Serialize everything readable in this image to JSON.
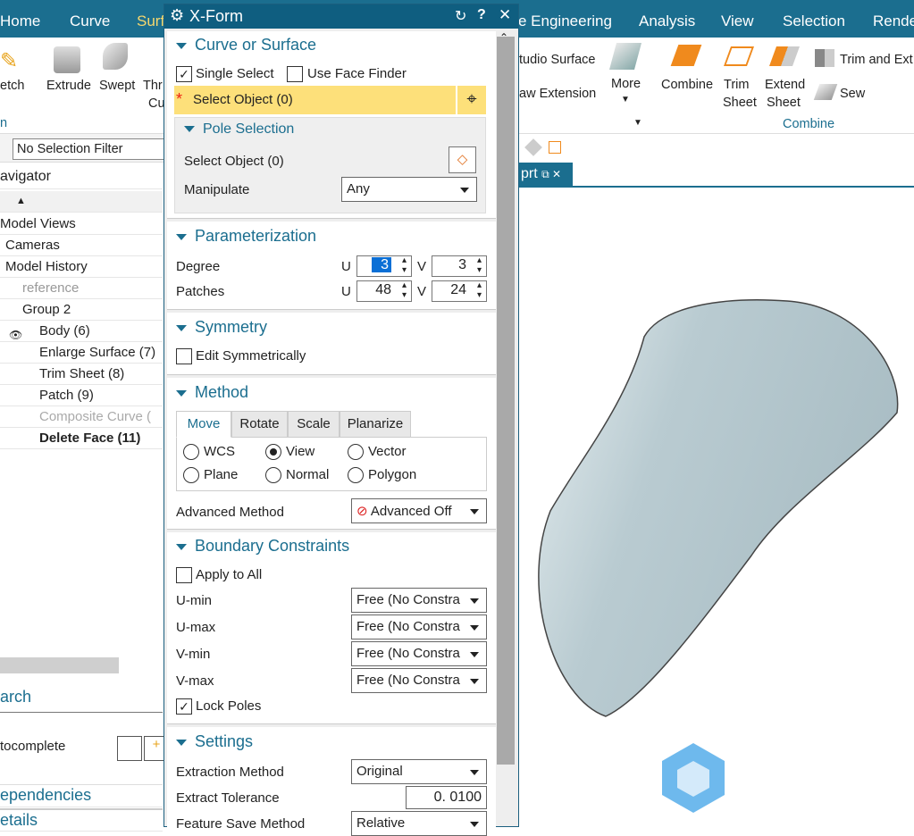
{
  "ribbon": {
    "tabs": [
      "Home",
      "Curve",
      "Surf",
      "e Engineering",
      "Analysis",
      "View",
      "Selection",
      "Rende"
    ],
    "buttons": {
      "sketch": "etch",
      "extrude": "Extrude",
      "swept": "Swept",
      "through": "Thr",
      "through2": "Cu",
      "studio": "tudio Surface",
      "extension": "aw Extension",
      "more": "More",
      "combine": "Combine",
      "trim_sheet_1": "Trim",
      "trim_sheet_2": "Sheet",
      "extend_sheet_1": "Extend",
      "extend_sheet_2": "Sheet",
      "trim_extend": "Trim and Ext",
      "sew": "Sew"
    },
    "group_left": "n",
    "group_combine": "Combine"
  },
  "selection_filter": "No Selection Filter",
  "navigator": {
    "title": "avigator",
    "items": [
      "Model Views",
      "Cameras",
      "Model History",
      "reference",
      "Group 2",
      "Body (6)",
      "Enlarge Surface (7)",
      "Trim Sheet (8)",
      "Patch (9)",
      "Composite Curve (",
      "Delete Face (11)"
    ],
    "search": "arch",
    "autocomplete": "tocomplete",
    "dependencies": "ependencies",
    "details": "etails"
  },
  "dialog": {
    "title": "X-Form",
    "curve_or_surface": {
      "header": "Curve or Surface",
      "single_select": "Single Select",
      "use_face_finder": "Use Face Finder",
      "select_object": "Select Object (0)",
      "pole_selection": {
        "header": "Pole Selection",
        "select_object": "Select Object (0)",
        "manipulate_label": "Manipulate",
        "manipulate_value": "Any"
      }
    },
    "parameterization": {
      "header": "Parameterization",
      "degree": "Degree",
      "patches": "Patches",
      "u": "U",
      "v": "V",
      "degree_u": "3",
      "degree_v": "3",
      "patches_u": "48",
      "patches_v": "24"
    },
    "symmetry": {
      "header": "Symmetry",
      "edit_symmetrically": "Edit Symmetrically"
    },
    "method": {
      "header": "Method",
      "tabs": [
        "Move",
        "Rotate",
        "Scale",
        "Planarize"
      ],
      "options": [
        "WCS",
        "View",
        "Vector",
        "Plane",
        "Normal",
        "Polygon"
      ],
      "selected": "View",
      "advanced_label": "Advanced Method",
      "advanced_value": "Advanced Off"
    },
    "boundary": {
      "header": "Boundary Constraints",
      "apply_to_all": "Apply to All",
      "rows": [
        {
          "label": "U-min",
          "value": "Free (No Constra"
        },
        {
          "label": "U-max",
          "value": "Free (No Constra"
        },
        {
          "label": "V-min",
          "value": "Free (No Constra"
        },
        {
          "label": "V-max",
          "value": "Free (No Constra"
        }
      ],
      "lock_poles": "Lock Poles"
    },
    "settings": {
      "header": "Settings",
      "extraction_label": "Extraction Method",
      "extraction_value": "Original",
      "tolerance_label": "Extract Tolerance",
      "tolerance_value": "0. 0100",
      "save_label": "Feature Save Method",
      "save_value": "Relative"
    }
  },
  "viewport": {
    "tab": "prt"
  },
  "colors": {
    "accent": "#1b6e8f",
    "highlight": "#fde07a",
    "surface": "#b9cbd1"
  }
}
